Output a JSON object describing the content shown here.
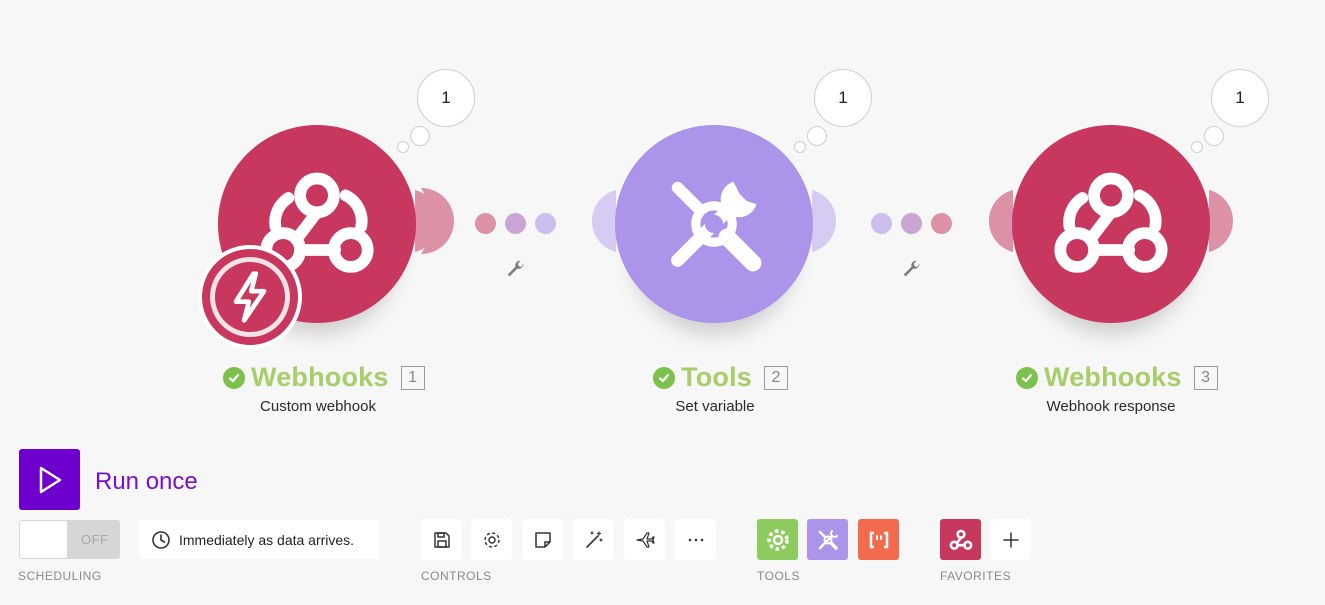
{
  "modules": [
    {
      "app": "Webhooks",
      "index": "1",
      "action": "Custom webhook",
      "bubble": "1",
      "color": "#c8375d",
      "icon": "webhook-icon",
      "trigger_badge": "lightning-icon"
    },
    {
      "app": "Tools",
      "index": "2",
      "action": "Set variable",
      "bubble": "1",
      "color": "#ab94e9",
      "icon": "tools-icon"
    },
    {
      "app": "Webhooks",
      "index": "3",
      "action": "Webhook response",
      "bubble": "1",
      "color": "#c8375d",
      "icon": "webhook-icon"
    }
  ],
  "run": {
    "label": "Run once"
  },
  "scheduling": {
    "toggle_state": "OFF",
    "schedule_text": "Immediately as data arrives.",
    "section_label": "SCHEDULING"
  },
  "controls": {
    "section_label": "CONTROLS",
    "buttons": [
      "save-icon",
      "gear-icon",
      "note-icon",
      "magic-wand-icon",
      "airplane-icon",
      "more-icon"
    ]
  },
  "tools": {
    "section_label": "TOOLS",
    "items": [
      {
        "icon": "gear-icon",
        "color": "#8ecb5f"
      },
      {
        "icon": "tools-icon",
        "color": "#ab94e9"
      },
      {
        "icon": "brackets-icon",
        "color": "#f26b4f"
      }
    ]
  },
  "favorites": {
    "section_label": "FAVORITES",
    "items": [
      {
        "icon": "webhook-icon",
        "color": "#c8375d"
      }
    ],
    "add_icon": "plus-icon"
  }
}
